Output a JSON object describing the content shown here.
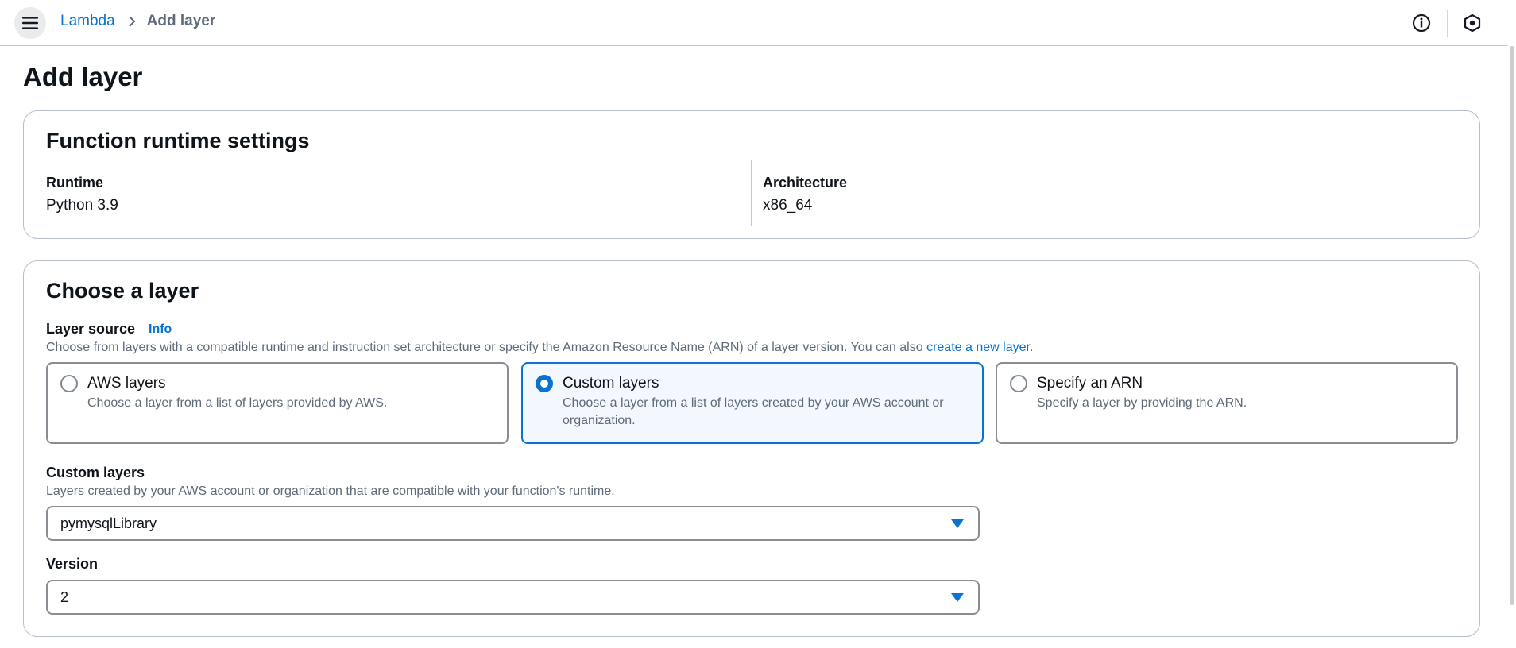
{
  "header": {
    "breadcrumb_root": "Lambda",
    "breadcrumb_current": "Add layer"
  },
  "page": {
    "title": "Add layer"
  },
  "runtime_settings": {
    "title": "Function runtime settings",
    "runtime_label": "Runtime",
    "runtime_value": "Python 3.9",
    "architecture_label": "Architecture",
    "architecture_value": "x86_64"
  },
  "choose_layer": {
    "title": "Choose a layer",
    "source_label": "Layer source",
    "info_link": "Info",
    "source_description": "Choose from layers with a compatible runtime and instruction set architecture or specify the Amazon Resource Name (ARN) of a layer version. You can also ",
    "source_description_link": "create a new layer",
    "source_description_end": ".",
    "options": [
      {
        "title": "AWS layers",
        "description": "Choose a layer from a list of layers provided by AWS.",
        "selected": false
      },
      {
        "title": "Custom layers",
        "description": "Choose a layer from a list of layers created by your AWS account or organization.",
        "selected": true
      },
      {
        "title": "Specify an ARN",
        "description": "Specify a layer by providing the ARN.",
        "selected": false
      }
    ],
    "custom_layers_label": "Custom layers",
    "custom_layers_description": "Layers created by your AWS account or organization that are compatible with your function's runtime.",
    "custom_layers_value": "pymysqlLibrary",
    "version_label": "Version",
    "version_value": "2"
  },
  "colors": {
    "accent": "#0972d3",
    "border": "#b6bec9",
    "selected_bg": "#f2f8fd"
  },
  "icons": {
    "menu": "hamburger-menu-icon",
    "separator": "chevron-right-icon",
    "info": "info-circle-icon",
    "notifications": "hexagon-icon"
  }
}
